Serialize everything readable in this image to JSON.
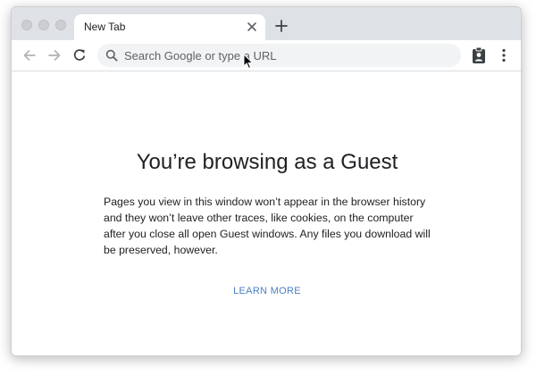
{
  "window": {
    "traffic_lights": [
      "close",
      "minimize",
      "maximize"
    ]
  },
  "tab": {
    "title": "New Tab",
    "close_icon": "close-icon"
  },
  "tabstrip": {
    "new_tab_icon": "plus-icon"
  },
  "toolbar": {
    "back_icon": "arrow-left-icon",
    "forward_icon": "arrow-right-icon",
    "reload_icon": "reload-icon",
    "profile_icon": "guest-profile-icon",
    "menu_icon": "more-vertical-icon"
  },
  "omnibox": {
    "placeholder": "Search Google or type a URL",
    "value": "",
    "icon": "search-icon"
  },
  "guest": {
    "title": "You’re browsing as a Guest",
    "body": "Pages you view in this window won’t appear in the browser history and they won’t leave other traces, like cookies, on the computer after you close all open Guest windows. Any files you download will be preserved, however.",
    "learn_more": "LEARN MORE"
  },
  "colors": {
    "tabstrip_bg": "#dee1e6",
    "omnibox_bg": "#f1f3f4",
    "link": "#4a7fc1",
    "text": "#202124"
  }
}
